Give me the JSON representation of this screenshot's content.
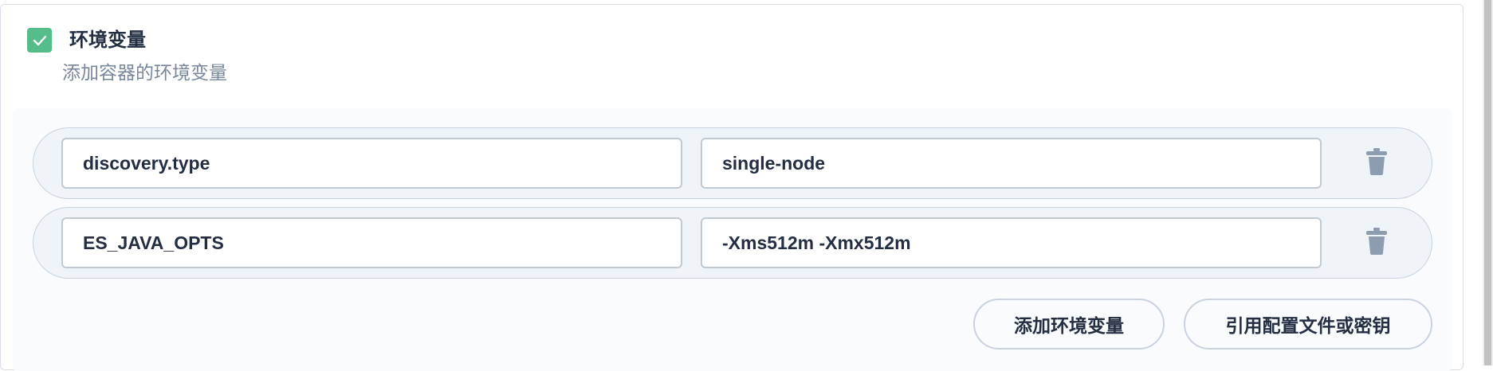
{
  "section": {
    "checkbox_checked": true,
    "title": "环境变量",
    "description": "添加容器的环境变量"
  },
  "env_vars": [
    {
      "key": "discovery.type",
      "value": "single-node"
    },
    {
      "key": "ES_JAVA_OPTS",
      "value": "-Xms512m -Xmx512m"
    }
  ],
  "buttons": {
    "add_label": "添加环境变量",
    "ref_label": "引用配置文件或密钥"
  },
  "icons": {
    "checkbox": "checkmark-icon",
    "delete": "trash-icon"
  },
  "colors": {
    "accent_green": "#55bc8a",
    "text_dark": "#242e42",
    "text_muted": "#79879c",
    "icon_gray": "#8d9db0"
  }
}
